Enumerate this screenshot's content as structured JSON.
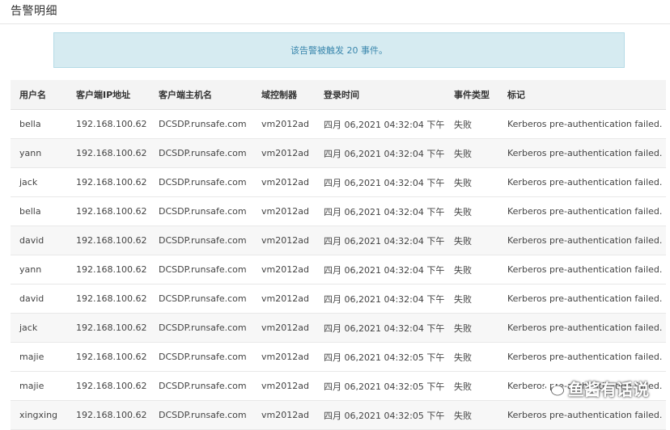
{
  "header": {
    "title": "告警明细"
  },
  "banner": {
    "text": "该告警被触发 20 事件。"
  },
  "table": {
    "columns": [
      "用户名",
      "客户端IP地址",
      "客户端主机名",
      "域控制器",
      "登录时间",
      "事件类型",
      "标记"
    ],
    "rows": [
      [
        "bella",
        "192.168.100.62",
        "DCSDP.runsafe.com",
        "vm2012ad",
        "四月 06,2021 04:32:04 下午",
        "失败",
        "Kerberos pre-authentication failed."
      ],
      [
        "yann",
        "192.168.100.62",
        "DCSDP.runsafe.com",
        "vm2012ad",
        "四月 06,2021 04:32:04 下午",
        "失败",
        "Kerberos pre-authentication failed."
      ],
      [
        "jack",
        "192.168.100.62",
        "DCSDP.runsafe.com",
        "vm2012ad",
        "四月 06,2021 04:32:04 下午",
        "失败",
        "Kerberos pre-authentication failed."
      ],
      [
        "bella",
        "192.168.100.62",
        "DCSDP.runsafe.com",
        "vm2012ad",
        "四月 06,2021 04:32:04 下午",
        "失败",
        "Kerberos pre-authentication failed."
      ],
      [
        "david",
        "192.168.100.62",
        "DCSDP.runsafe.com",
        "vm2012ad",
        "四月 06,2021 04:32:04 下午",
        "失败",
        "Kerberos pre-authentication failed."
      ],
      [
        "yann",
        "192.168.100.62",
        "DCSDP.runsafe.com",
        "vm2012ad",
        "四月 06,2021 04:32:04 下午",
        "失败",
        "Kerberos pre-authentication failed."
      ],
      [
        "david",
        "192.168.100.62",
        "DCSDP.runsafe.com",
        "vm2012ad",
        "四月 06,2021 04:32:04 下午",
        "失败",
        "Kerberos pre-authentication failed."
      ],
      [
        "jack",
        "192.168.100.62",
        "DCSDP.runsafe.com",
        "vm2012ad",
        "四月 06,2021 04:32:04 下午",
        "失败",
        "Kerberos pre-authentication failed."
      ],
      [
        "majie",
        "192.168.100.62",
        "DCSDP.runsafe.com",
        "vm2012ad",
        "四月 06,2021 04:32:05 下午",
        "失败",
        "Kerberos pre-authentication failed."
      ],
      [
        "majie",
        "192.168.100.62",
        "DCSDP.runsafe.com",
        "vm2012ad",
        "四月 06,2021 04:32:05 下午",
        "失败",
        "Kerberos pre-authentication failed."
      ],
      [
        "xingxing",
        "192.168.100.62",
        "DCSDP.runsafe.com",
        "vm2012ad",
        "四月 06,2021 04:32:05 下午",
        "失败",
        "Kerberos pre-authentication failed."
      ]
    ]
  },
  "watermark": {
    "text": "鱼酱有话说",
    "icon": "wechat-icon"
  }
}
